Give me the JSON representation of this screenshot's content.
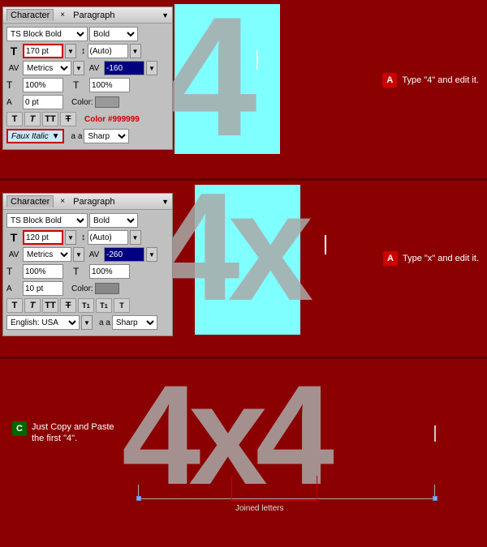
{
  "sections": [
    {
      "id": "section1",
      "bg": "#8b0000"
    },
    {
      "id": "section2",
      "bg": "#8b0000"
    },
    {
      "id": "section3",
      "bg": "#8b0000"
    }
  ],
  "panel1": {
    "title": "Character",
    "tab1": "Character",
    "tab2": "Paragraph",
    "close_label": "×",
    "font_name": "TS Block Bold",
    "font_style": "Bold",
    "size": "170 pt",
    "leading": "(Auto)",
    "tracking": "Metrics",
    "kerning": "-160",
    "scale_h": "100%",
    "scale_v": "100%",
    "baseline": "0 pt",
    "color_label": "Color:",
    "color_value": "#999999",
    "color_hex_label": "Color #999999",
    "faux_italic": "Faux Italic",
    "sharp": "Sharp",
    "aa_label": "a a"
  },
  "panel2": {
    "title": "Character",
    "tab1": "Character",
    "tab2": "Paragraph",
    "close_label": "×",
    "font_name": "TS Block Bold",
    "font_style": "Bold",
    "size": "120 pt",
    "leading": "(Auto)",
    "tracking": "Metrics",
    "kerning": "-260",
    "scale_h": "100%",
    "scale_v": "100%",
    "baseline": "10 pt",
    "color_label": "Color:",
    "sharp": "Sharp",
    "aa_label": "a a",
    "language": "English: USA"
  },
  "callouts": {
    "a1_label": "Type \"4\" and edit it.",
    "a2_label": "Type \"x\" and edit it.",
    "c_label": "Just Copy and Paste\nthe first \"4\".",
    "joined_label": "Joined letters"
  },
  "letters": {
    "top_4": "4",
    "mid_4x": "4x",
    "bottom_4x4": "4x4"
  }
}
